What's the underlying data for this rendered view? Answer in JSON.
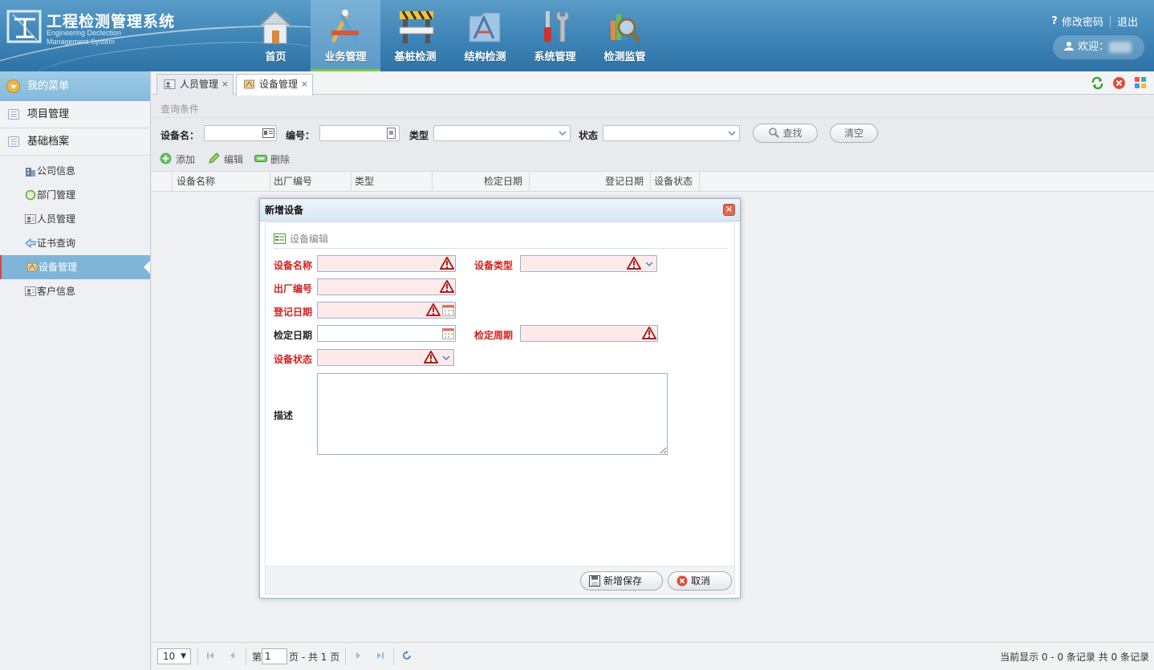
{
  "header": {
    "title": "工程检测管理系统",
    "subtitle_line1": "Engineering Dectection",
    "subtitle_line2": "Management System",
    "change_password": "修改密码",
    "logout": "退出",
    "welcome": "欢迎：",
    "nav": [
      {
        "label": "首页",
        "icon": "home-icon"
      },
      {
        "label": "业务管理",
        "icon": "tools-icon",
        "active": true
      },
      {
        "label": "基桩检测",
        "icon": "barrier-icon"
      },
      {
        "label": "结构检测",
        "icon": "folder-icon"
      },
      {
        "label": "系统管理",
        "icon": "wrench-icon"
      },
      {
        "label": "检测监管",
        "icon": "magnifier-icon"
      }
    ]
  },
  "sidebar": {
    "title": "我的菜单",
    "groups": [
      "项目管理",
      "基础档案"
    ],
    "items": [
      {
        "label": "公司信息",
        "icon": "building-icon"
      },
      {
        "label": "部门管理",
        "icon": "circle-icon"
      },
      {
        "label": "人员管理",
        "icon": "person-card-icon"
      },
      {
        "label": "证书查询",
        "icon": "arrow-left-icon"
      },
      {
        "label": "设备管理",
        "icon": "equipment-icon",
        "active": true
      },
      {
        "label": "客户信息",
        "icon": "person-card-icon"
      }
    ]
  },
  "tabs": [
    {
      "label": "人员管理",
      "close": "×"
    },
    {
      "label": "设备管理",
      "close": "×",
      "active": true
    }
  ],
  "query": {
    "section_title": "查询条件",
    "name_label": "设备名：",
    "number_label": "编号：",
    "type_label": "类型",
    "status_label": "状态",
    "search_button": "查找",
    "clear_button": "清空"
  },
  "toolbar": {
    "add": "添加",
    "edit": "编辑",
    "delete": "删除"
  },
  "grid": {
    "columns": [
      "设备名称",
      "出厂编号",
      "类型",
      "检定日期",
      "登记日期",
      "设备状态"
    ]
  },
  "dialog": {
    "title": "新增设备",
    "close": "×",
    "section": "设备编辑",
    "fields": {
      "name": "设备名称",
      "type": "设备类型",
      "serial": "出厂编号",
      "register_date": "登记日期",
      "verify_date": "检定日期",
      "verify_period": "检定周期",
      "status": "设备状态",
      "description": "描述"
    },
    "save_button": "新增保存",
    "cancel_button": "取消"
  },
  "pager": {
    "page_size": "10",
    "page_prefix": "第",
    "page_number": "1",
    "page_suffix": "页 - 共 1 页",
    "summary": "当前显示 0 - 0 条记录 共 0 条记录"
  },
  "colors": {
    "header_blue": "#3d84b6",
    "required_red": "#d0231f",
    "active_nav_underline": "#7cc94e",
    "sidebar_active": "#7fb5d9"
  }
}
